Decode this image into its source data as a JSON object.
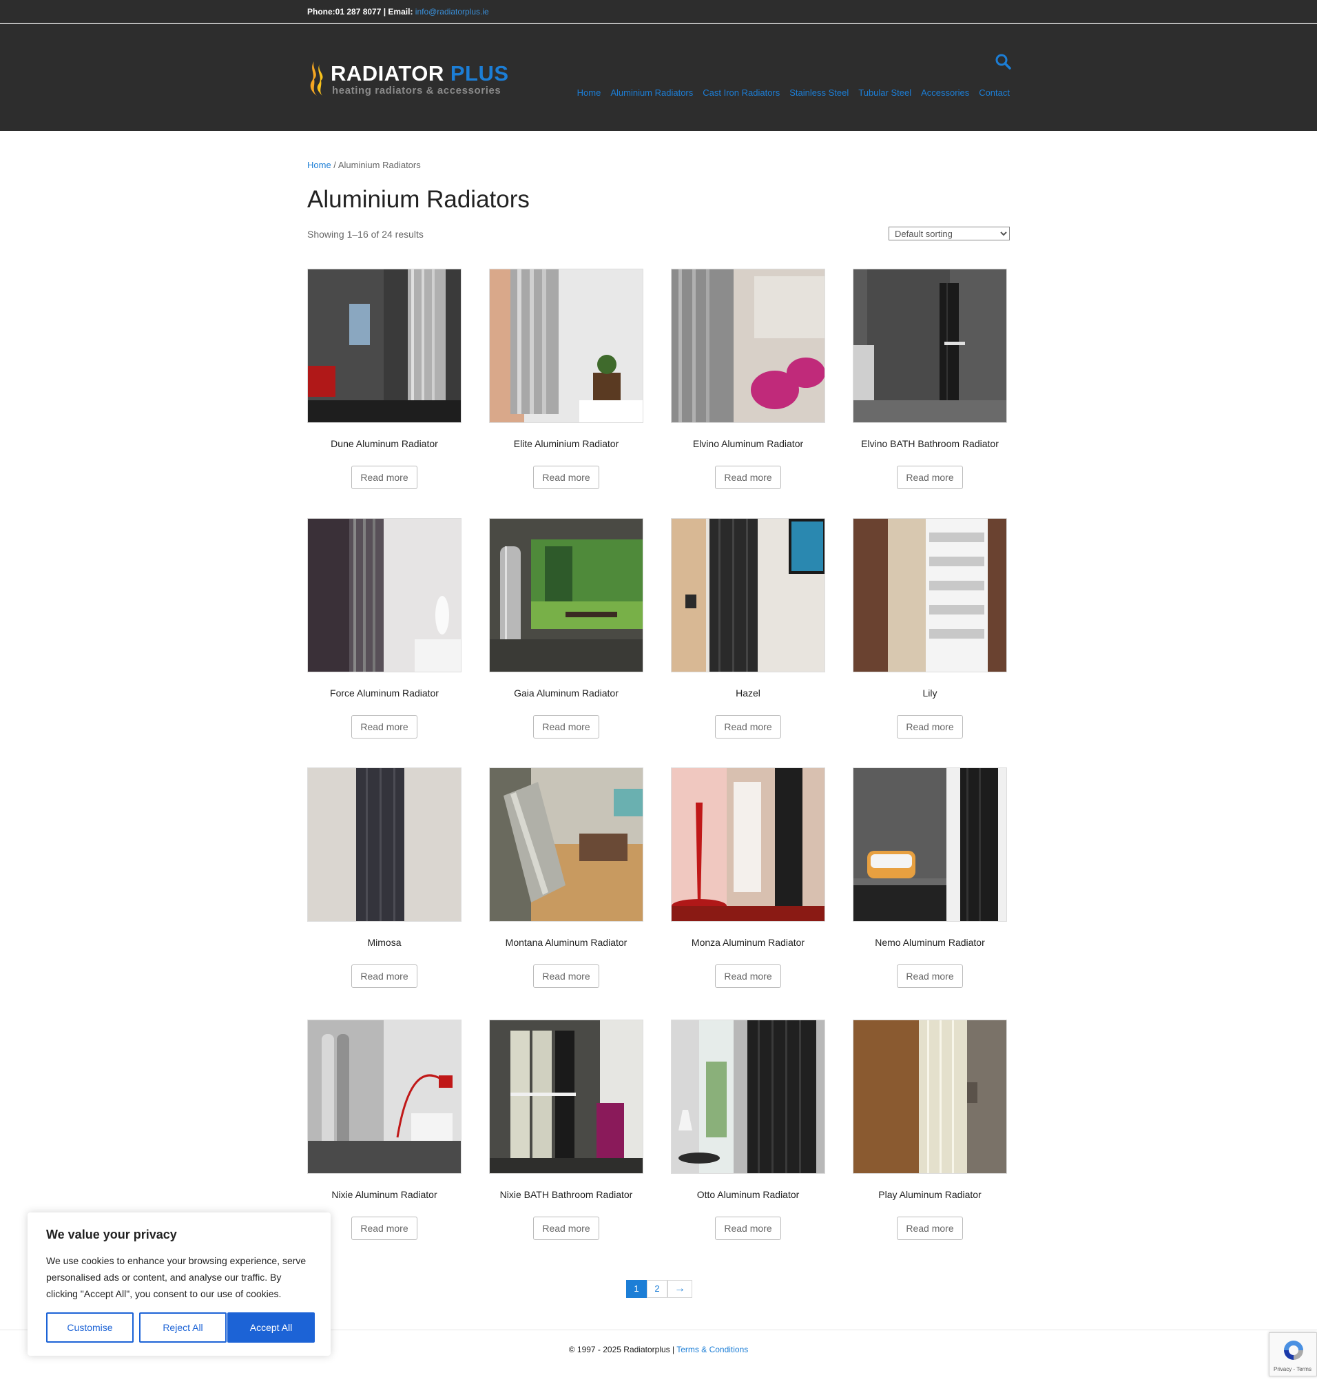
{
  "topbar": {
    "phone_label": "Phone:01 287 8077 | Email: ",
    "email": "info@radiatorplus.ie"
  },
  "header": {
    "brand_main": "RADIATOR",
    "brand_plus": "PLUS",
    "tagline": "heating radiators & accessories",
    "search_icon": "search-icon",
    "nav": [
      {
        "label": "Home"
      },
      {
        "label": "Aluminium Radiators"
      },
      {
        "label": "Cast Iron Radiators"
      },
      {
        "label": "Stainless Steel"
      },
      {
        "label": "Tubular Steel"
      },
      {
        "label": "Accessories"
      },
      {
        "label": "Contact"
      }
    ]
  },
  "breadcrumb": {
    "home": "Home",
    "separator": " / ",
    "current": "Aluminium Radiators"
  },
  "page": {
    "title": "Aluminium Radiators",
    "result_count": "Showing 1–16 of 24 results",
    "sort_selected": "Default sorting"
  },
  "products": [
    {
      "name": "Dune Aluminum Radiator",
      "button": "Read more"
    },
    {
      "name": "Elite Aluminium Radiator",
      "button": "Read more"
    },
    {
      "name": "Elvino Aluminum Radiator",
      "button": "Read more"
    },
    {
      "name": "Elvino BATH Bathroom Radiator",
      "button": "Read more"
    },
    {
      "name": "Force Aluminum Radiator",
      "button": "Read more"
    },
    {
      "name": "Gaia Aluminum Radiator",
      "button": "Read more"
    },
    {
      "name": "Hazel",
      "button": "Read more"
    },
    {
      "name": "Lily",
      "button": "Read more"
    },
    {
      "name": "Mimosa",
      "button": "Read more"
    },
    {
      "name": "Montana Aluminum Radiator",
      "button": "Read more"
    },
    {
      "name": "Monza Aluminum Radiator",
      "button": "Read more"
    },
    {
      "name": "Nemo Aluminum Radiator",
      "button": "Read more"
    },
    {
      "name": "Nixie Aluminum Radiator",
      "button": "Read more"
    },
    {
      "name": "Nixie BATH Bathroom Radiator",
      "button": "Read more"
    },
    {
      "name": "Otto Aluminum Radiator",
      "button": "Read more"
    },
    {
      "name": "Play Aluminum Radiator",
      "button": "Read more"
    }
  ],
  "pagination": {
    "current": "1",
    "page2": "2",
    "next": "→"
  },
  "footer": {
    "copyright": "© 1997 - 2025 Radiatorplus | ",
    "terms": "Terms & Conditions"
  },
  "cookie": {
    "title": "We value your privacy",
    "text": "We use cookies to enhance your browsing experience, serve personalised ads or content, and analyse our traffic. By clicking \"Accept All\", you consent to our use of cookies.",
    "customise": "Customise",
    "reject": "Reject All",
    "accept": "Accept All"
  },
  "recaptcha": {
    "text": "Privacy - Terms"
  },
  "colors": {
    "header_bg": "#2d2d2d",
    "accent": "#1c7ed6",
    "cookie_button": "#1c63d6"
  }
}
